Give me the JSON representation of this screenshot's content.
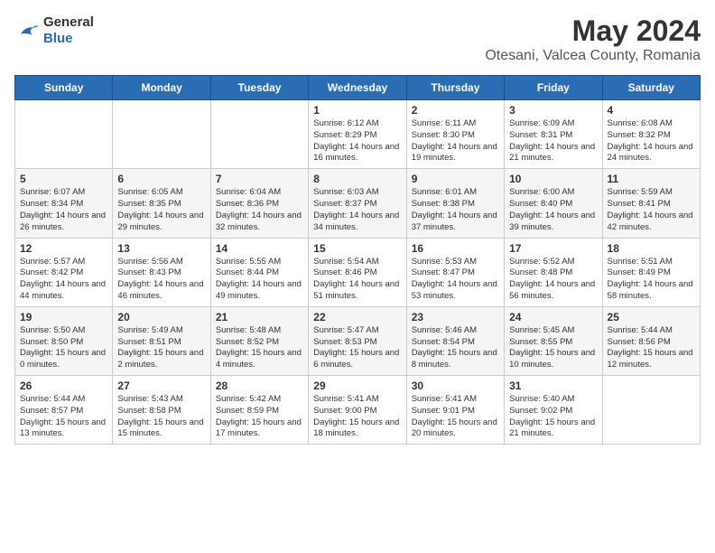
{
  "logo": {
    "general": "General",
    "blue": "Blue"
  },
  "title": "May 2024",
  "subtitle": "Otesani, Valcea County, Romania",
  "days": [
    "Sunday",
    "Monday",
    "Tuesday",
    "Wednesday",
    "Thursday",
    "Friday",
    "Saturday"
  ],
  "weeks": [
    [
      {
        "num": "",
        "sunrise": "",
        "sunset": "",
        "daylight": ""
      },
      {
        "num": "",
        "sunrise": "",
        "sunset": "",
        "daylight": ""
      },
      {
        "num": "",
        "sunrise": "",
        "sunset": "",
        "daylight": ""
      },
      {
        "num": "1",
        "sunrise": "6:12 AM",
        "sunset": "8:29 PM",
        "daylight": "14 hours and 16 minutes."
      },
      {
        "num": "2",
        "sunrise": "6:11 AM",
        "sunset": "8:30 PM",
        "daylight": "14 hours and 19 minutes."
      },
      {
        "num": "3",
        "sunrise": "6:09 AM",
        "sunset": "8:31 PM",
        "daylight": "14 hours and 21 minutes."
      },
      {
        "num": "4",
        "sunrise": "6:08 AM",
        "sunset": "8:32 PM",
        "daylight": "14 hours and 24 minutes."
      }
    ],
    [
      {
        "num": "5",
        "sunrise": "6:07 AM",
        "sunset": "8:34 PM",
        "daylight": "14 hours and 26 minutes."
      },
      {
        "num": "6",
        "sunrise": "6:05 AM",
        "sunset": "8:35 PM",
        "daylight": "14 hours and 29 minutes."
      },
      {
        "num": "7",
        "sunrise": "6:04 AM",
        "sunset": "8:36 PM",
        "daylight": "14 hours and 32 minutes."
      },
      {
        "num": "8",
        "sunrise": "6:03 AM",
        "sunset": "8:37 PM",
        "daylight": "14 hours and 34 minutes."
      },
      {
        "num": "9",
        "sunrise": "6:01 AM",
        "sunset": "8:38 PM",
        "daylight": "14 hours and 37 minutes."
      },
      {
        "num": "10",
        "sunrise": "6:00 AM",
        "sunset": "8:40 PM",
        "daylight": "14 hours and 39 minutes."
      },
      {
        "num": "11",
        "sunrise": "5:59 AM",
        "sunset": "8:41 PM",
        "daylight": "14 hours and 42 minutes."
      }
    ],
    [
      {
        "num": "12",
        "sunrise": "5:57 AM",
        "sunset": "8:42 PM",
        "daylight": "14 hours and 44 minutes."
      },
      {
        "num": "13",
        "sunrise": "5:56 AM",
        "sunset": "8:43 PM",
        "daylight": "14 hours and 46 minutes."
      },
      {
        "num": "14",
        "sunrise": "5:55 AM",
        "sunset": "8:44 PM",
        "daylight": "14 hours and 49 minutes."
      },
      {
        "num": "15",
        "sunrise": "5:54 AM",
        "sunset": "8:46 PM",
        "daylight": "14 hours and 51 minutes."
      },
      {
        "num": "16",
        "sunrise": "5:53 AM",
        "sunset": "8:47 PM",
        "daylight": "14 hours and 53 minutes."
      },
      {
        "num": "17",
        "sunrise": "5:52 AM",
        "sunset": "8:48 PM",
        "daylight": "14 hours and 56 minutes."
      },
      {
        "num": "18",
        "sunrise": "5:51 AM",
        "sunset": "8:49 PM",
        "daylight": "14 hours and 58 minutes."
      }
    ],
    [
      {
        "num": "19",
        "sunrise": "5:50 AM",
        "sunset": "8:50 PM",
        "daylight": "15 hours and 0 minutes."
      },
      {
        "num": "20",
        "sunrise": "5:49 AM",
        "sunset": "8:51 PM",
        "daylight": "15 hours and 2 minutes."
      },
      {
        "num": "21",
        "sunrise": "5:48 AM",
        "sunset": "8:52 PM",
        "daylight": "15 hours and 4 minutes."
      },
      {
        "num": "22",
        "sunrise": "5:47 AM",
        "sunset": "8:53 PM",
        "daylight": "15 hours and 6 minutes."
      },
      {
        "num": "23",
        "sunrise": "5:46 AM",
        "sunset": "8:54 PM",
        "daylight": "15 hours and 8 minutes."
      },
      {
        "num": "24",
        "sunrise": "5:45 AM",
        "sunset": "8:55 PM",
        "daylight": "15 hours and 10 minutes."
      },
      {
        "num": "25",
        "sunrise": "5:44 AM",
        "sunset": "8:56 PM",
        "daylight": "15 hours and 12 minutes."
      }
    ],
    [
      {
        "num": "26",
        "sunrise": "5:44 AM",
        "sunset": "8:57 PM",
        "daylight": "15 hours and 13 minutes."
      },
      {
        "num": "27",
        "sunrise": "5:43 AM",
        "sunset": "8:58 PM",
        "daylight": "15 hours and 15 minutes."
      },
      {
        "num": "28",
        "sunrise": "5:42 AM",
        "sunset": "8:59 PM",
        "daylight": "15 hours and 17 minutes."
      },
      {
        "num": "29",
        "sunrise": "5:41 AM",
        "sunset": "9:00 PM",
        "daylight": "15 hours and 18 minutes."
      },
      {
        "num": "30",
        "sunrise": "5:41 AM",
        "sunset": "9:01 PM",
        "daylight": "15 hours and 20 minutes."
      },
      {
        "num": "31",
        "sunrise": "5:40 AM",
        "sunset": "9:02 PM",
        "daylight": "15 hours and 21 minutes."
      },
      {
        "num": "",
        "sunrise": "",
        "sunset": "",
        "daylight": ""
      }
    ]
  ],
  "labels": {
    "sunrise_prefix": "Sunrise: ",
    "sunset_prefix": "Sunset: ",
    "daylight_prefix": "Daylight: "
  }
}
